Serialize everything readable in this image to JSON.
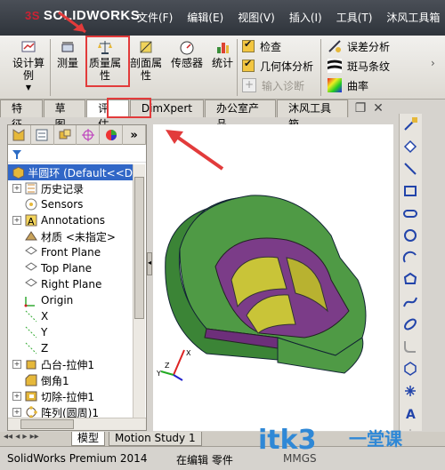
{
  "app": {
    "logo_text": "SOLIDWORKS",
    "menu": [
      "文件(F)",
      "编辑(E)",
      "视图(V)",
      "插入(I)",
      "工具(T)",
      "沐风工具箱"
    ]
  },
  "toolbar": {
    "design_study": "设计算\n例",
    "measure": "测量",
    "mass_properties": "质量属\n性",
    "section_properties": "剖面属\n性",
    "sensor": "传感器",
    "statistics": "统计",
    "check": "检查",
    "geometry_analysis": "几何体分析",
    "import_diagnostics": "输入诊断",
    "deviation_analysis": "误差分析",
    "zebra_stripes": "斑马条纹",
    "curvature": "曲率"
  },
  "tabs": [
    {
      "label": "特征",
      "active": false
    },
    {
      "label": "草图",
      "active": false
    },
    {
      "label": "评估",
      "active": true
    },
    {
      "label": "DimXpert",
      "active": false
    },
    {
      "label": "办公室产品",
      "active": false
    },
    {
      "label": "沐风工具箱",
      "active": false
    }
  ],
  "tree": {
    "root": "半圆环  (Default<<D",
    "items": [
      {
        "label": "历史记录",
        "icon": "history-icon",
        "expandable": true
      },
      {
        "label": "Sensors",
        "icon": "sensor-icon",
        "expandable": false
      },
      {
        "label": "Annotations",
        "icon": "annotation-icon",
        "expandable": true
      },
      {
        "label": "材质 <未指定>",
        "icon": "material-icon",
        "expandable": false
      },
      {
        "label": "Front Plane",
        "icon": "plane-icon",
        "expandable": false
      },
      {
        "label": "Top Plane",
        "icon": "plane-icon",
        "expandable": false
      },
      {
        "label": "Right Plane",
        "icon": "plane-icon",
        "expandable": false
      },
      {
        "label": "Origin",
        "icon": "origin-icon",
        "expandable": false
      },
      {
        "label": "X",
        "icon": "axis-icon",
        "expandable": false
      },
      {
        "label": "Y",
        "icon": "axis-icon",
        "expandable": false
      },
      {
        "label": "Z",
        "icon": "axis-icon",
        "expandable": false
      },
      {
        "label": "凸台-拉伸1",
        "icon": "extrude-icon",
        "expandable": true
      },
      {
        "label": "倒角1",
        "icon": "chamfer-icon",
        "expandable": false
      },
      {
        "label": "切除-拉伸1",
        "icon": "cut-extrude-icon",
        "expandable": true
      },
      {
        "label": "阵列(圆周)1",
        "icon": "pattern-icon",
        "expandable": true
      }
    ]
  },
  "bottom_tabs": [
    "模型",
    "Motion Study 1"
  ],
  "status": {
    "app_version": "SolidWorks Premium 2014",
    "mode": "在编辑 零件",
    "units": "MMGS"
  },
  "watermark": {
    "text": "itk3",
    "cn": "一堂课"
  },
  "colors": {
    "title_bg": "#353a41",
    "active_tab": "#ffffff",
    "selection": "#3167c7",
    "annotation_red": "#e23b3b",
    "part_green": "#3d8c3f",
    "part_purple": "#7c3a8a",
    "part_yellow": "#c8c236"
  }
}
